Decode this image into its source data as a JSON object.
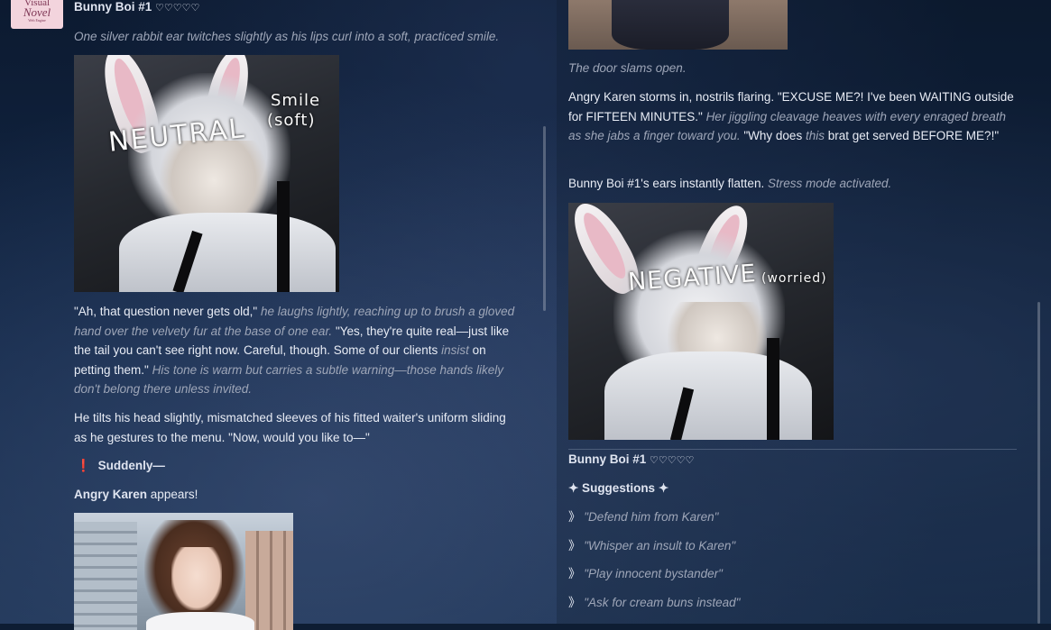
{
  "left": {
    "avatar": {
      "line1": "Visual",
      "line2": "Novel",
      "line3": "Web Engine"
    },
    "speaker": "Bunny Boi #1",
    "hearts": "♡♡♡♡♡",
    "intro": "One silver rabbit ear twitches slightly as his lips curl into a soft, practiced smile.",
    "image1": {
      "label_main": "NEUTRAL",
      "label_sub1": "Smile",
      "label_sub2": "(soft)"
    },
    "p1": {
      "s1": "\"Ah, that question never gets old,\"",
      "a1": "he laughs lightly, reaching up to brush a gloved hand over the velvety fur at the base of one ear.",
      "s2": "\"Yes, they're quite real—just like the tail you can't see right now. Careful, though. Some of our clients",
      "em": "insist",
      "s3": "on petting them.\"",
      "a2": "His tone is warm but carries a subtle warning—those hands likely don't belong there unless invited."
    },
    "p2": "He tilts his head slightly, mismatched sleeves of his fitted waiter's uniform sliding as he gestures to the menu. \"Now, would you like to—\"",
    "sudden_icon": "❗",
    "sudden": "Suddenly—",
    "appears_name": "Angry Karen",
    "appears_rest": "appears!"
  },
  "right": {
    "door": "The door slams open.",
    "karen": {
      "s1": "Angry Karen storms in, nostrils flaring. \"EXCUSE ME?! I've been WAITING outside for FIFTEEN MINUTES.\"",
      "a1": "Her jiggling cleavage heaves with every enraged breath as she jabs a finger toward you.",
      "s2": "\"Why does",
      "em": "this",
      "s3": "brat get served BEFORE ME?!\""
    },
    "ears": {
      "s1": "Bunny Boi #1's ears instantly flatten.",
      "a1": "Stress mode activated."
    },
    "image2": {
      "label_main": "NEGATIVE",
      "label_sub": "(worried)"
    },
    "speaker": "Bunny Boi #1",
    "hearts": "♡♡♡♡♡",
    "suggestions_title": "✦ Suggestions ✦",
    "suggestion_marker": "》",
    "suggestions": [
      "\"Defend him from Karen\"",
      "\"Whisper an insult to Karen\"",
      "\"Play innocent bystander\"",
      "\"Ask for cream buns instead\""
    ]
  }
}
